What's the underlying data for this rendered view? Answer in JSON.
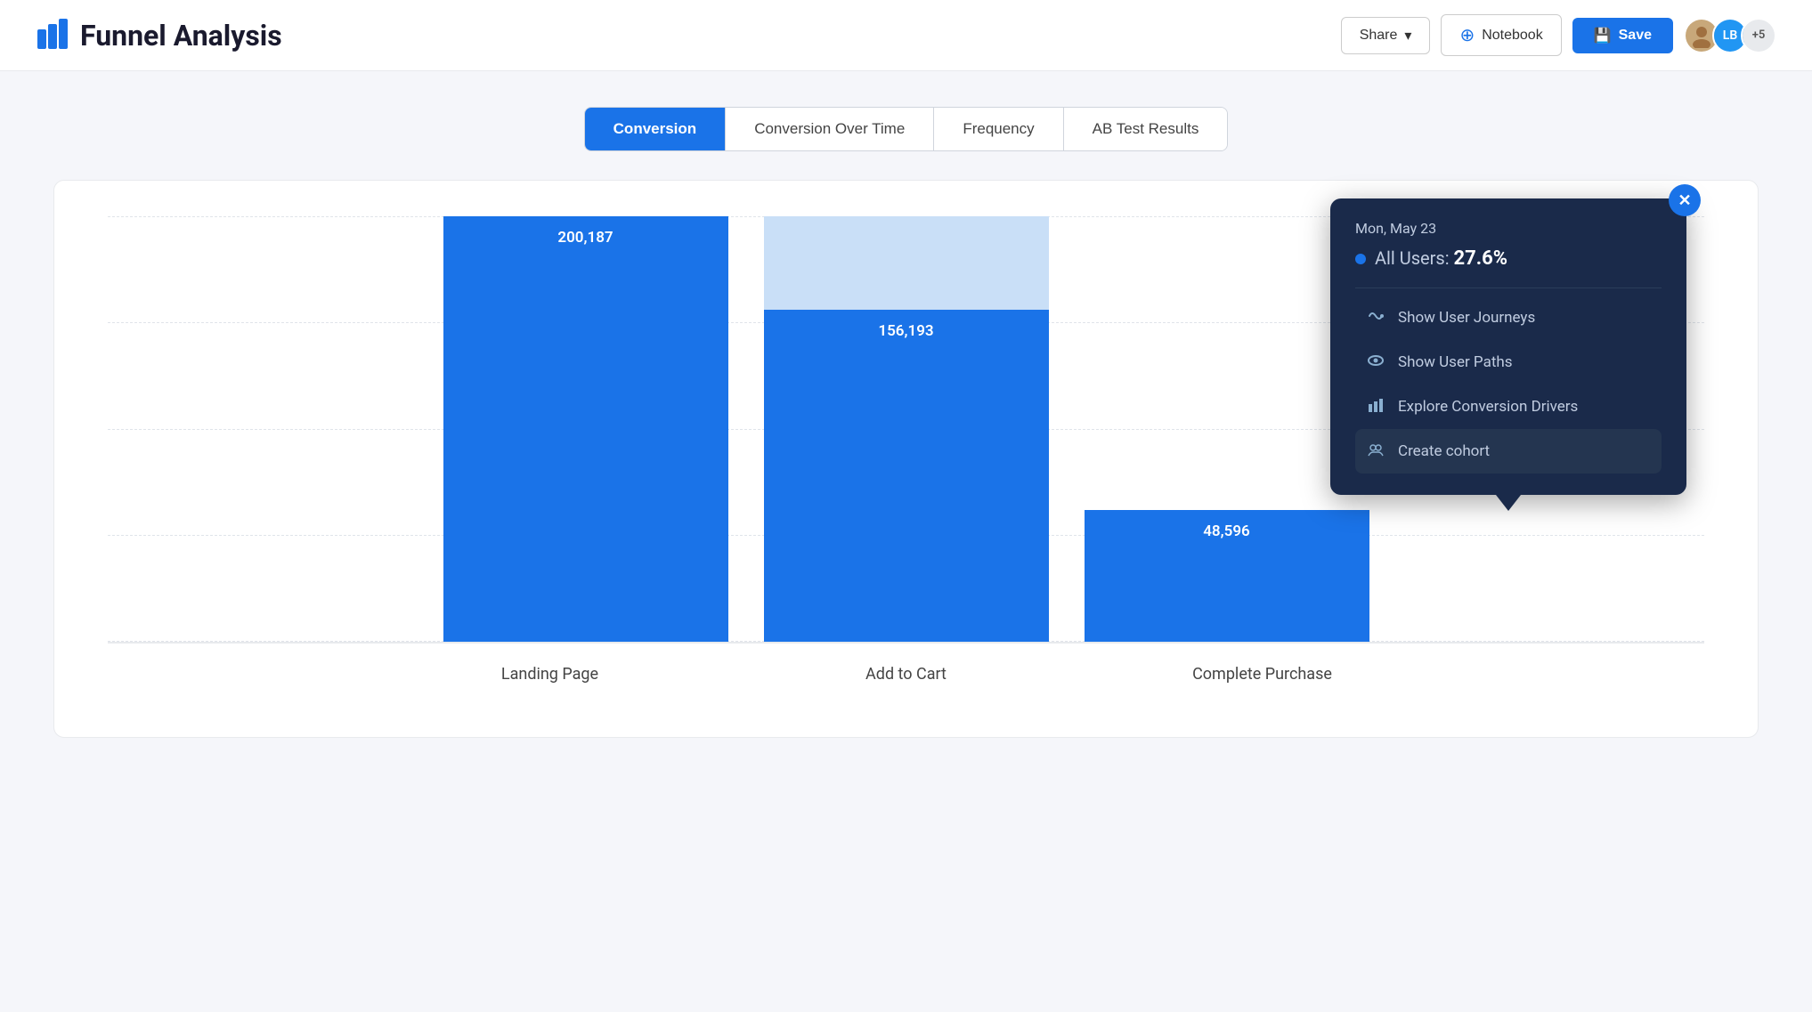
{
  "header": {
    "app_icon_label": "mixpanel-icon",
    "title": "Funnel Analysis",
    "share_label": "Share",
    "notebook_label": "Notebook",
    "save_label": "Save",
    "avatar_lb": "LB",
    "avatar_plus": "+5"
  },
  "tabs": [
    {
      "id": "conversion",
      "label": "Conversion",
      "active": true
    },
    {
      "id": "conversion-over-time",
      "label": "Conversion Over Time",
      "active": false
    },
    {
      "id": "frequency",
      "label": "Frequency",
      "active": false
    },
    {
      "id": "ab-test",
      "label": "AB Test Results",
      "active": false
    }
  ],
  "chart": {
    "bars": [
      {
        "id": "landing-page",
        "label": "Landing Page",
        "value": "200,187",
        "height_pct": 100
      },
      {
        "id": "add-to-cart",
        "label": "Add to Cart",
        "value": "156,193",
        "height_pct": 78,
        "light_pct": 22
      },
      {
        "id": "complete-purchase",
        "label": "Complete Purchase",
        "value": "48,596",
        "height_pct": 31
      }
    ],
    "grid_lines": 5
  },
  "tooltip": {
    "date": "Mon, May 23",
    "users_label": "All Users:",
    "users_value": "27.6%",
    "menu_items": [
      {
        "id": "show-user-journeys",
        "label": "Show User Journeys",
        "icon": "journey-icon"
      },
      {
        "id": "show-user-paths",
        "label": "Show User Paths",
        "icon": "eye-icon"
      },
      {
        "id": "explore-conversion",
        "label": "Explore Conversion Drivers",
        "icon": "bar-icon"
      },
      {
        "id": "create-cohort",
        "label": "Create cohort",
        "icon": "cohort-icon"
      }
    ]
  },
  "colors": {
    "primary": "#1a73e8",
    "bar_light": "#c9dff7",
    "tooltip_bg": "#1a2a4a",
    "active_item_bg": "#243550"
  }
}
